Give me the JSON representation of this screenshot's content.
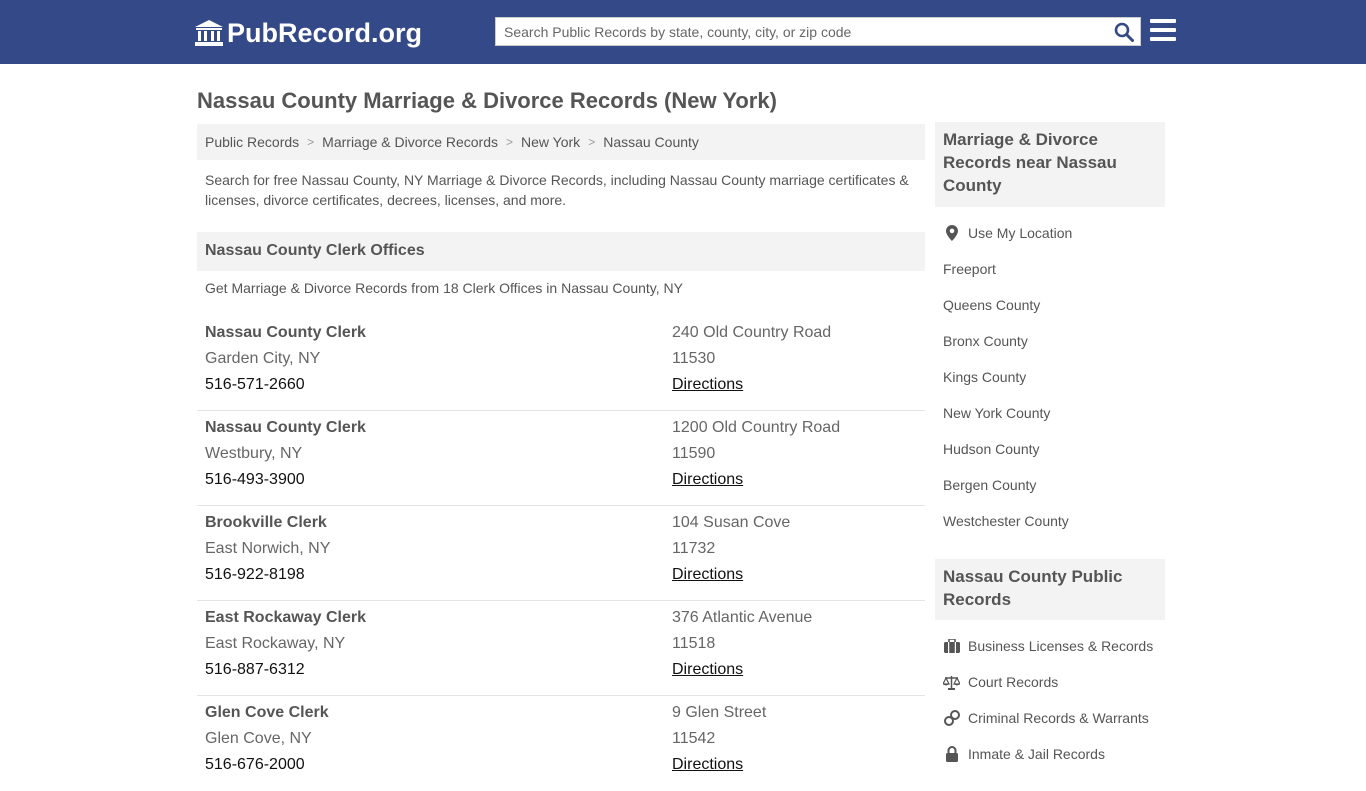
{
  "header": {
    "logo_text": "PubRecord.org",
    "search_placeholder": "Search Public Records by state, county, city, or zip code"
  },
  "page_title": "Nassau County Marriage & Divorce Records (New York)",
  "breadcrumb": [
    "Public Records",
    "Marriage & Divorce Records",
    "New York",
    "Nassau County"
  ],
  "intro": "Search for free Nassau County, NY Marriage & Divorce Records, including Nassau County marriage certificates & licenses, divorce certificates, decrees, licenses, and more.",
  "clerk_section": {
    "title": "Nassau County Clerk Offices",
    "subtitle": "Get Marriage & Divorce Records from 18 Clerk Offices in Nassau County, NY",
    "offices": [
      {
        "name": "Nassau County Clerk",
        "city": "Garden City, NY",
        "phone": "516-571-2660",
        "address": "240 Old Country Road",
        "zip": "11530",
        "directions": "Directions"
      },
      {
        "name": "Nassau County Clerk",
        "city": "Westbury, NY",
        "phone": "516-493-3900",
        "address": "1200 Old Country Road",
        "zip": "11590",
        "directions": "Directions"
      },
      {
        "name": "Brookville Clerk",
        "city": "East Norwich, NY",
        "phone": "516-922-8198",
        "address": "104 Susan Cove",
        "zip": "11732",
        "directions": "Directions"
      },
      {
        "name": "East Rockaway Clerk",
        "city": "East Rockaway, NY",
        "phone": "516-887-6312",
        "address": "376 Atlantic Avenue",
        "zip": "11518",
        "directions": "Directions"
      },
      {
        "name": "Glen Cove Clerk",
        "city": "Glen Cove, NY",
        "phone": "516-676-2000",
        "address": "9 Glen Street",
        "zip": "11542",
        "directions": "Directions"
      }
    ]
  },
  "sidebar": {
    "nearby_title": "Marriage & Divorce Records near Nassau County",
    "nearby_items": [
      "Use My Location",
      "Freeport",
      "Queens County",
      "Bronx County",
      "Kings County",
      "New York County",
      "Hudson County",
      "Bergen County",
      "Westchester County"
    ],
    "public_title": "Nassau County Public Records",
    "public_items": [
      {
        "label": "Business Licenses & Records",
        "icon": "briefcase-icon"
      },
      {
        "label": "Court Records",
        "icon": "scales-icon"
      },
      {
        "label": "Criminal Records & Warrants",
        "icon": "handcuffs-icon"
      },
      {
        "label": "Inmate & Jail Records",
        "icon": "lock-icon"
      }
    ]
  },
  "colors": {
    "header_bg": "#344a88",
    "panel_bg": "#f3f3f3",
    "search_icon": "#344a88"
  }
}
